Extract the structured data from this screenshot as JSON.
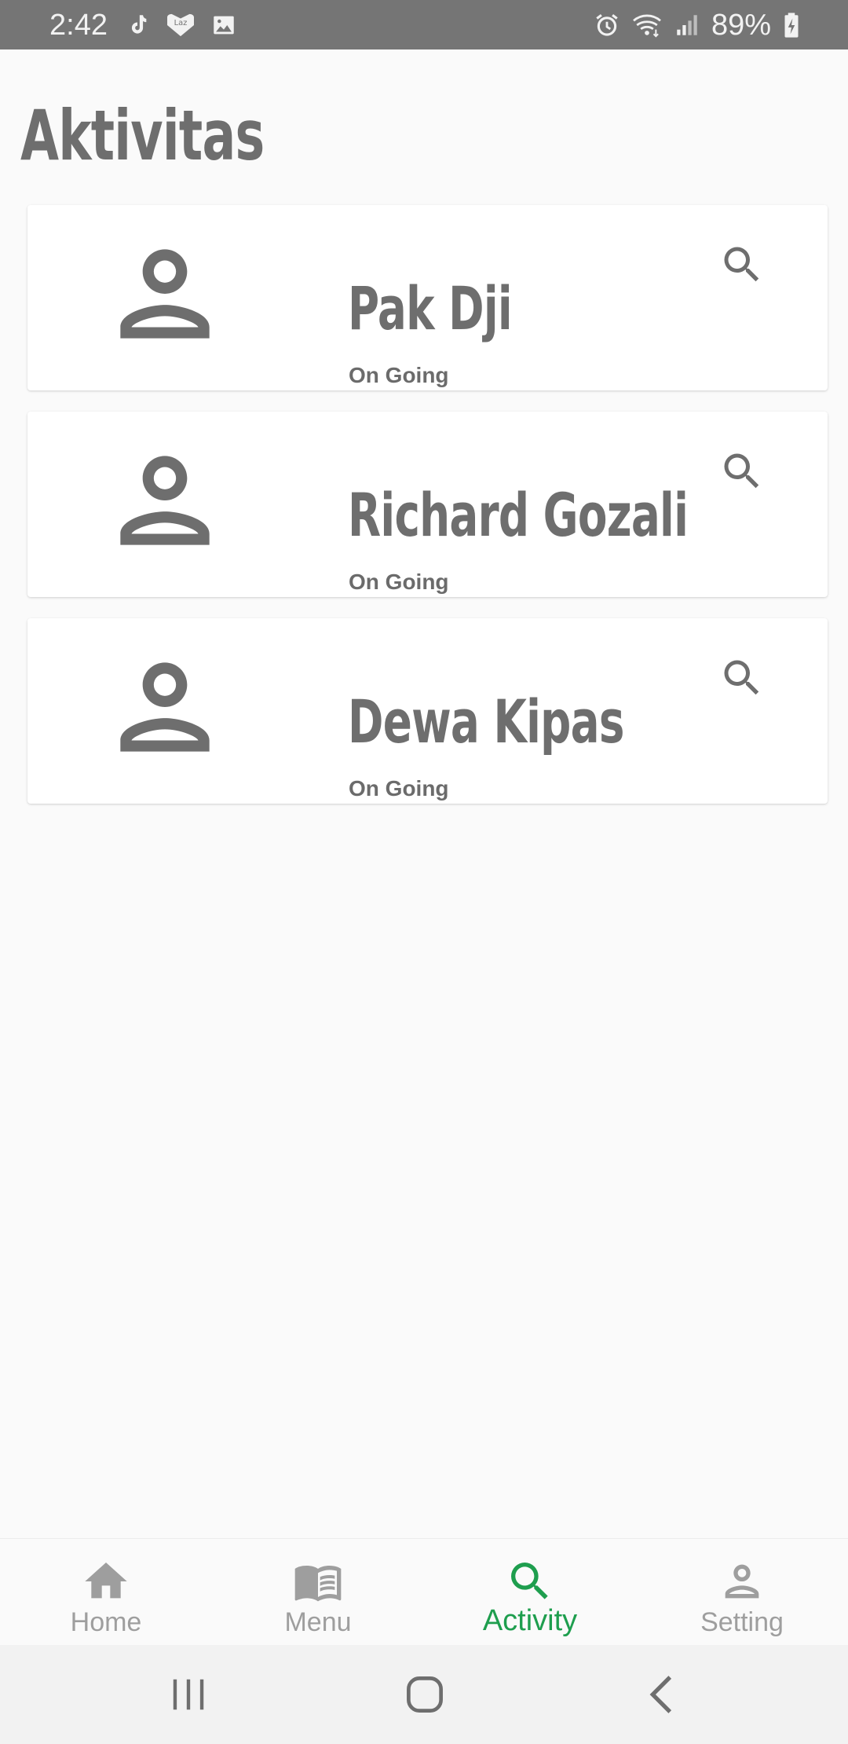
{
  "status_bar": {
    "time": "2:42",
    "battery": "89%",
    "left_icons": [
      "tiktok-icon",
      "lazada-icon",
      "gallery-icon"
    ],
    "right_icons": [
      "alarm-icon",
      "wifi-icon",
      "signal-icon",
      "battery-charging-icon"
    ]
  },
  "page": {
    "title": "Aktivitas"
  },
  "activities": [
    {
      "name": "Pak Dji",
      "status": "On Going",
      "avatar_icon": "person-icon",
      "action_icon": "search-icon"
    },
    {
      "name": "Richard Gozali",
      "status": "On Going",
      "avatar_icon": "person-icon",
      "action_icon": "search-icon"
    },
    {
      "name": "Dewa Kipas",
      "status": "On Going",
      "avatar_icon": "person-icon",
      "action_icon": "search-icon"
    }
  ],
  "bottom_nav": {
    "items": [
      {
        "label": "Home",
        "icon": "home-icon",
        "active": false
      },
      {
        "label": "Menu",
        "icon": "book-icon",
        "active": false
      },
      {
        "label": "Activity",
        "icon": "search-icon",
        "active": true
      },
      {
        "label": "Setting",
        "icon": "person-icon",
        "active": false
      }
    ]
  },
  "system_nav": {
    "buttons": [
      "recents-icon",
      "home-circle-icon",
      "back-icon"
    ]
  },
  "colors": {
    "status_bar_bg": "#757575",
    "text_gray": "#6e6e6e",
    "active_green": "#1e9e4e",
    "inactive_gray": "#9e9e9e",
    "page_bg": "#fafafa"
  }
}
